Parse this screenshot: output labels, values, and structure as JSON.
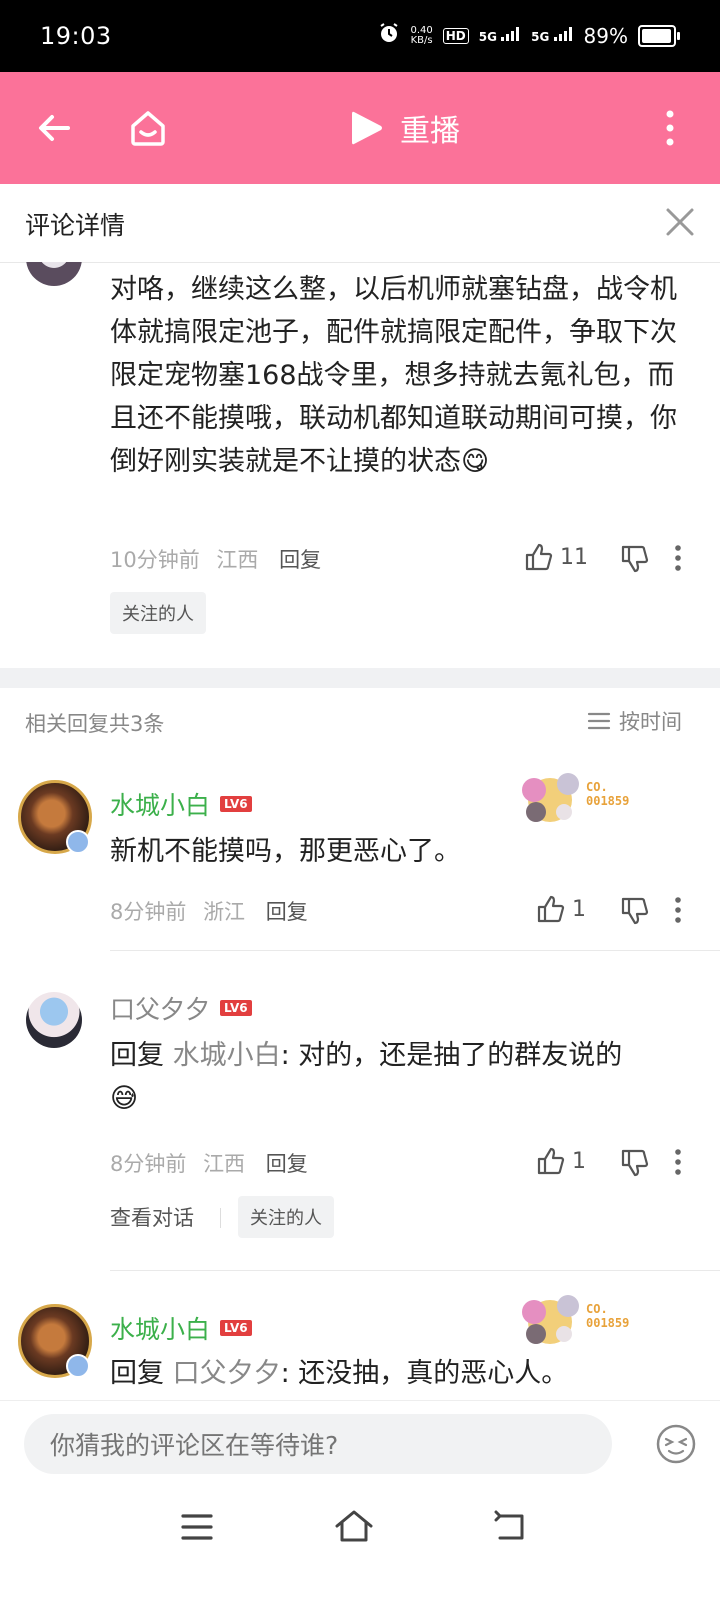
{
  "status": {
    "time": "19:03",
    "speed_top": "0.40",
    "speed_bottom": "KB/s",
    "hd": "HD",
    "net1": "5G",
    "net2": "5G",
    "battery": "89%"
  },
  "header": {
    "title": "重播"
  },
  "subheader": {
    "title": "评论详情"
  },
  "main_comment": {
    "text": "对咯，继续这么整，以后机师就塞钻盘，战令机体就搞限定池子，配件就搞限定配件，争取下次限定宠物塞168战令里，想多持就去氪礼包，而且还不能摸哦，联动机都知道联动期间可摸，你倒好刚实装就是不让摸的状态",
    "emoji": "😋",
    "time": "10分钟前",
    "location": "江西",
    "reply_label": "回复",
    "likes": "11",
    "tag": "关注的人"
  },
  "replies_header": {
    "count_label": "相关回复共3条",
    "sort_label": "按时间"
  },
  "replies": [
    {
      "username": "水城小白",
      "level": "LV6",
      "badge_no": "CO.\n001859",
      "text": "新机不能摸吗，那更恶心了。",
      "time": "8分钟前",
      "location": "浙江",
      "reply_label": "回复",
      "likes": "1"
    },
    {
      "username": "口父夕夕",
      "level": "LV6",
      "reply_prefix": "回复",
      "reply_to": "水城小白",
      "text": ": 对的，还是抽了的群友说的",
      "emoji": "😅",
      "time": "8分钟前",
      "location": "江西",
      "reply_label": "回复",
      "likes": "1",
      "view_conversation": "查看对话",
      "tag": "关注的人"
    },
    {
      "username": "水城小白",
      "level": "LV6",
      "badge_no": "CO.\n001859",
      "reply_prefix": "回复",
      "reply_to": "口父夕夕",
      "text": ": 还没抽，真的恶心人。"
    }
  ],
  "bottom": {
    "placeholder": "你猜我的评论区在等待谁?"
  },
  "colors": {
    "header_pink": "#fb7299",
    "username_green": "#3cb04b",
    "level_red": "#e23f3f"
  }
}
